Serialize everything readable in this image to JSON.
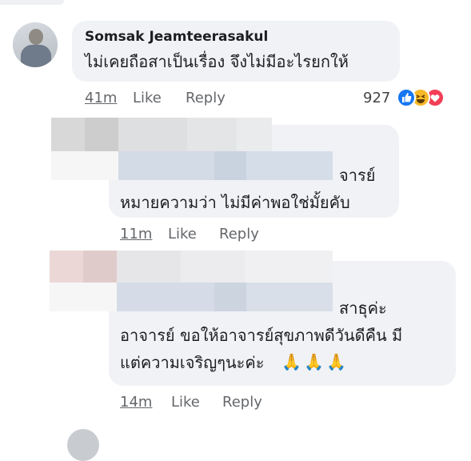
{
  "comments": [
    {
      "author": "Somsak Jeamteerasakul",
      "text": "ไม่เคยถือสาเป็นเรื่อง จึงไม่มีอะไรยกให้",
      "time": "41m",
      "like_label": "Like",
      "reply_label": "Reply",
      "reaction_count": "927",
      "reactions": [
        "like-reaction-icon",
        "haha-reaction-icon",
        "love-reaction-icon"
      ]
    },
    {
      "author_blurred": true,
      "lines": [
        "จารย์",
        "หมายความว่า ไม่มีค่าพอใช่มั้ยคับ"
      ],
      "time": "11m",
      "like_label": "Like",
      "reply_label": "Reply"
    },
    {
      "author_blurred": true,
      "lines": [
        "สาธุค่ะ",
        "อาจารย์ ขอให้อาจารย์สุขภาพดีวันดีคืน มี",
        "แต่ความเจริญๆนะค่ะ"
      ],
      "emoji": [
        "🙏",
        "🙏",
        "🙏"
      ],
      "time": "14m",
      "like_label": "Like",
      "reply_label": "Reply"
    }
  ],
  "colors": {
    "bubble": "#f0f2f5",
    "secondary_text": "#65676b",
    "like_blue": "#1877f2",
    "haha_yellow": "#f7b928",
    "love_red": "#f33e58"
  }
}
